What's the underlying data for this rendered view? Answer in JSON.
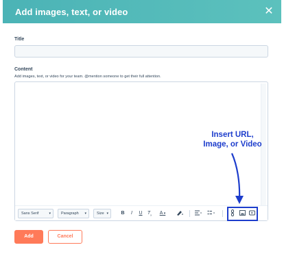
{
  "modal": {
    "title": "Add images, text, or video",
    "close_glyph": "✕"
  },
  "form": {
    "title_label": "Title",
    "title_value": "",
    "content_label": "Content",
    "content_helper": "Add images, text, or video for your team. @mention someone to get their full attention."
  },
  "toolbar": {
    "font_select": "Sans Serif",
    "format_select": "Paragraph",
    "size_select": "Size",
    "bold": "B",
    "italic": "I",
    "underline": "U",
    "clear_format": "T̸",
    "text_color": "A",
    "icons": [
      "bold-icon",
      "italic-icon",
      "underline-icon",
      "clear-format-icon",
      "text-color-icon",
      "highlight-icon",
      "align-icon",
      "list-icon",
      "link-icon",
      "image-icon",
      "video-icon"
    ]
  },
  "annotation": {
    "line1": "Insert URL,",
    "line2": "Image, or Video",
    "color": "#1d3dcc"
  },
  "actions": {
    "add_label": "Add",
    "cancel_label": "Cancel",
    "accent_color": "#ff7a59"
  },
  "colors": {
    "header_teal": "#4bb3b6"
  }
}
